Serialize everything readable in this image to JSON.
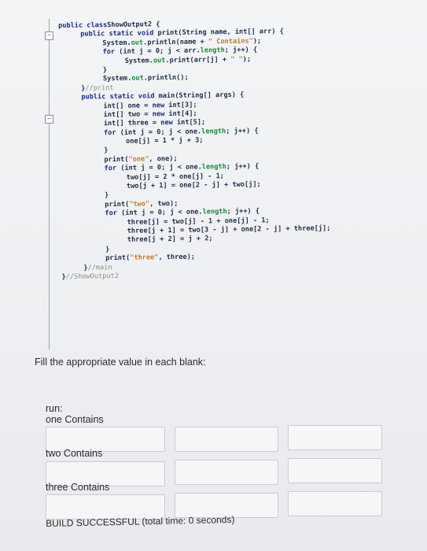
{
  "code": {
    "lines": [
      {
        "indent": 0,
        "parts": [
          [
            "kw",
            "public class"
          ],
          [
            "",
            "ShowOutput2 {"
          ]
        ]
      },
      {
        "indent": 1,
        "parts": [
          [
            "kw",
            "public static void"
          ],
          [
            "",
            " print(String name, int[] arr) {"
          ]
        ]
      },
      {
        "indent": 2,
        "parts": [
          [
            "",
            "System."
          ],
          [
            "fld",
            "out"
          ],
          [
            "",
            ".println(name + "
          ],
          [
            "str",
            "\" Contains\""
          ],
          [
            "",
            ");"
          ]
        ]
      },
      {
        "indent": 2,
        "parts": [
          [
            "kw",
            "for"
          ],
          [
            "",
            " (int j = 0; j < arr."
          ],
          [
            "fld",
            "length"
          ],
          [
            "",
            "; j++) {"
          ]
        ]
      },
      {
        "indent": 3,
        "parts": [
          [
            "",
            "System."
          ],
          [
            "fld",
            "out"
          ],
          [
            "",
            ".print(arr[j] + "
          ],
          [
            "str",
            "\" \""
          ],
          [
            "",
            ");"
          ]
        ]
      },
      {
        "indent": 2,
        "parts": [
          [
            "",
            "}"
          ]
        ]
      },
      {
        "indent": 2,
        "parts": [
          [
            "",
            "System."
          ],
          [
            "fld",
            "out"
          ],
          [
            "",
            ".println();"
          ]
        ]
      },
      {
        "indent": 1,
        "parts": [
          [
            "",
            "}"
          ],
          [
            "cmt",
            "//print"
          ]
        ]
      },
      {
        "indent": 1,
        "parts": [
          [
            "kw",
            "public static void"
          ],
          [
            "",
            " main(String[] args) {"
          ]
        ]
      },
      {
        "indent": 2,
        "parts": [
          [
            "",
            "int[] one = "
          ],
          [
            "kw",
            "new"
          ],
          [
            "",
            " int[3];"
          ]
        ]
      },
      {
        "indent": 2,
        "parts": [
          [
            "",
            "int[] two = "
          ],
          [
            "kw",
            "new"
          ],
          [
            "",
            " int[4];"
          ]
        ]
      },
      {
        "indent": 2,
        "parts": [
          [
            "",
            "int[] three = "
          ],
          [
            "kw",
            "new"
          ],
          [
            "",
            " int[5];"
          ]
        ]
      },
      {
        "indent": 2,
        "parts": [
          [
            "kw",
            "for"
          ],
          [
            "",
            " (int j = 0; j < one."
          ],
          [
            "fld",
            "length"
          ],
          [
            "",
            "; j++) {"
          ]
        ]
      },
      {
        "indent": 3,
        "parts": [
          [
            "",
            "one[j] = 1 * j + 3;"
          ]
        ]
      },
      {
        "indent": 2,
        "parts": [
          [
            "",
            "}"
          ]
        ]
      },
      {
        "indent": 2,
        "parts": [
          [
            "",
            "print("
          ],
          [
            "str",
            "\"one\""
          ],
          [
            "",
            ", one);"
          ]
        ]
      },
      {
        "indent": 2,
        "parts": [
          [
            "kw",
            "for"
          ],
          [
            "",
            " (int j = 0; j < one."
          ],
          [
            "fld",
            "length"
          ],
          [
            "",
            "; j++) {"
          ]
        ]
      },
      {
        "indent": 3,
        "parts": [
          [
            "",
            "two[j] = 2 * one[j] - 1;"
          ]
        ]
      },
      {
        "indent": 3,
        "parts": [
          [
            "",
            "two[j + 1] = one[2 - j] + two[j];"
          ]
        ]
      },
      {
        "indent": 2,
        "parts": [
          [
            "",
            "}"
          ]
        ]
      },
      {
        "indent": 2,
        "parts": [
          [
            "",
            "print("
          ],
          [
            "str",
            "\"two\""
          ],
          [
            "",
            ", two);"
          ]
        ]
      },
      {
        "indent": 2,
        "parts": [
          [
            "kw",
            "for"
          ],
          [
            "",
            " (int j = 0; j < one."
          ],
          [
            "fld",
            "length"
          ],
          [
            "",
            "; j++) {"
          ]
        ]
      },
      {
        "indent": 3,
        "parts": [
          [
            "",
            "three[j] = two[j] - 1 + one[j] - 1;"
          ]
        ]
      },
      {
        "indent": 3,
        "parts": [
          [
            "",
            "three[j + 1] = two[3 - j] + one[2 - j] + three[j];"
          ]
        ]
      },
      {
        "indent": 3,
        "parts": [
          [
            "",
            "three[j + 2] = j + 2;"
          ]
        ]
      },
      {
        "indent": 2,
        "parts": [
          [
            "",
            "}"
          ]
        ]
      },
      {
        "indent": 2,
        "parts": [
          [
            "",
            "print("
          ],
          [
            "str",
            "\"three\""
          ],
          [
            "",
            ", three);"
          ]
        ]
      },
      {
        "indent": 1,
        "parts": [
          [
            "",
            "}"
          ],
          [
            "cmt",
            "//main"
          ]
        ]
      },
      {
        "indent": 0,
        "parts": [
          [
            "",
            "}"
          ],
          [
            "cmt",
            "//ShowOutput2"
          ]
        ]
      }
    ]
  },
  "question": "Fill the appropriate value in each blank:",
  "output": {
    "run_label": "run:",
    "one_label": "one Contains",
    "two_label": "two Contains",
    "three_label": "three Contains",
    "build_status": "BUILD SUCCESSFUL (total time: 0 seconds)"
  },
  "colors": {
    "keyword": "#1b2a8a",
    "string": "#c07a2a",
    "field": "#198a3a",
    "comment": "#8c8c8c"
  }
}
